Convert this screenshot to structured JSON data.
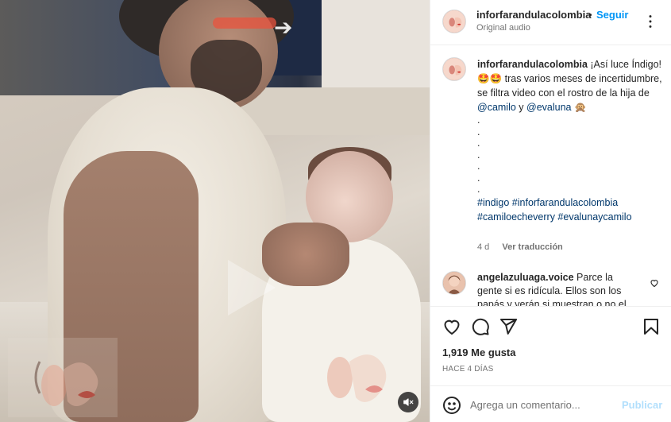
{
  "header": {
    "username": "inforfarandulacolombia",
    "separator": "•",
    "follow_label": "Seguir",
    "audio_label": "Original audio"
  },
  "caption": {
    "username": "inforfarandulacolombia",
    "text_1": " ¡Así luce Índigo! 🤩🤩 tras varios meses de incertidumbre, se filtra video con el rostro de la hija de ",
    "mention_1": "@camilo",
    "text_2": " y ",
    "mention_2": "@evaluna",
    "text_3": " 🙊",
    "dots": [
      ".",
      ".",
      ".",
      ".",
      ".",
      ".",
      "."
    ],
    "hashtags_line_1": "#indigo #inforfarandulacolombia",
    "hashtags_line_2": "#camiloecheverry #evalunaycamilo",
    "age": "4 d",
    "translate_label": "Ver traducción"
  },
  "reply": {
    "username": "angelazuluaga.voice",
    "text": " Parce la gente si es ridícula. Ellos son los papás y verán si muestran o no el rostro de"
  },
  "actions": {
    "icons": [
      "heart-icon",
      "comment-icon",
      "share-icon",
      "bookmark-icon"
    ],
    "likes": "1,919 Me gusta",
    "date": "HACE 4 DÍAS"
  },
  "comment_box": {
    "placeholder": "Agrega un comentario...",
    "post_label": "Publicar"
  },
  "video": {
    "muted": true,
    "controls": [
      "mute-icon"
    ]
  },
  "colors": {
    "accent": "#0095f6",
    "link": "#00376b",
    "muted_text": "#737373",
    "post_disabled": "#b2dffc"
  }
}
